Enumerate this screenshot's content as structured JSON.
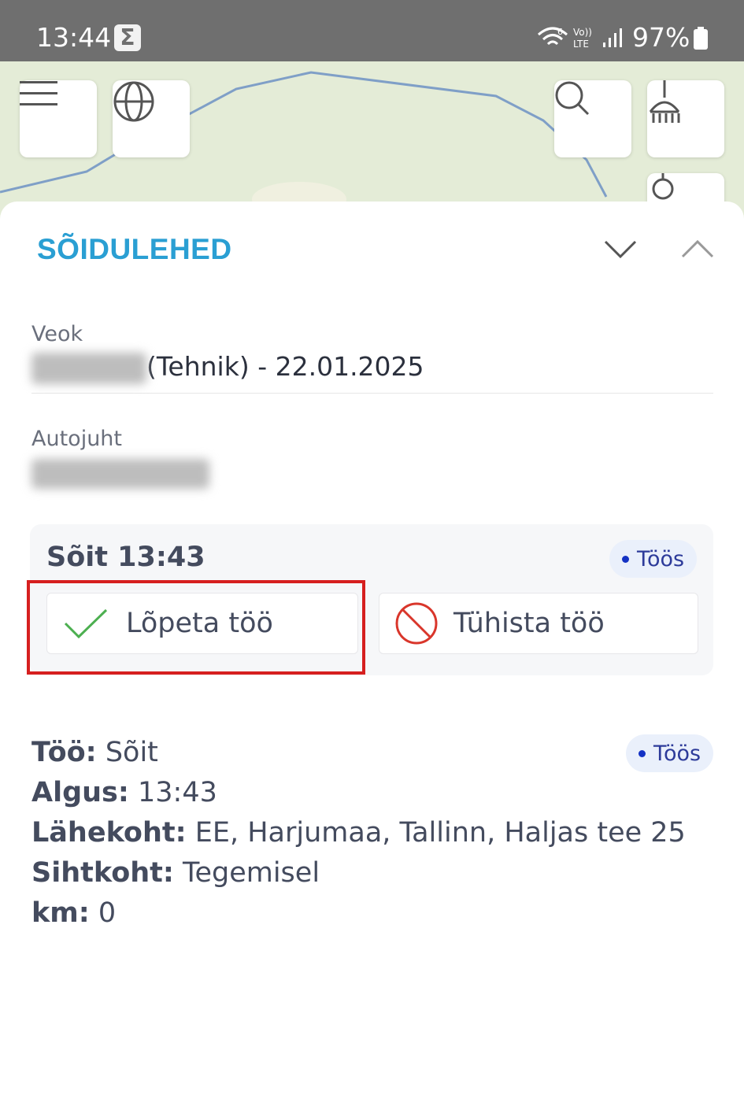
{
  "status_bar": {
    "time": "13:44",
    "notification_icon": "sigma-icon",
    "battery": "97%",
    "icons": [
      "wifi-icon",
      "volte-icon",
      "signal-icon",
      "battery-icon"
    ]
  },
  "map_toolbar": {
    "left_buttons": [
      "menu-icon",
      "globe-icon"
    ],
    "right_buttons": [
      "search-icon",
      "broom-icon"
    ]
  },
  "sheet": {
    "title": "SÕIDULEHED",
    "collapse_icon": "chevron-down-icon",
    "expand_icon": "chevron-up-icon"
  },
  "vehicle": {
    "label": "Veok",
    "value_suffix": "(Tehnik) - 22.01.2025"
  },
  "driver": {
    "label": "Autojuht"
  },
  "trip": {
    "title": "Sõit 13:43",
    "status": "Töös",
    "finish_label": "Lõpeta töö",
    "cancel_label": "Tühista töö"
  },
  "job": {
    "status": "Töös",
    "rows": [
      {
        "key": "Töö:",
        "value": " Sõit"
      },
      {
        "key": "Algus:",
        "value": " 13:43"
      },
      {
        "key": "Lähekoht:",
        "value": " EE, Harjumaa, Tallinn, Haljas tee 25"
      },
      {
        "key": "Sihtkoht:",
        "value": " Tegemisel"
      },
      {
        "key": "km:",
        "value": " 0"
      }
    ]
  },
  "colors": {
    "title_accent": "#2a9fd3",
    "status_bar_bg": "#6f6f6f",
    "highlight": "#d61f1f",
    "check_green": "#4caf50",
    "cancel_red": "#d9362b"
  }
}
